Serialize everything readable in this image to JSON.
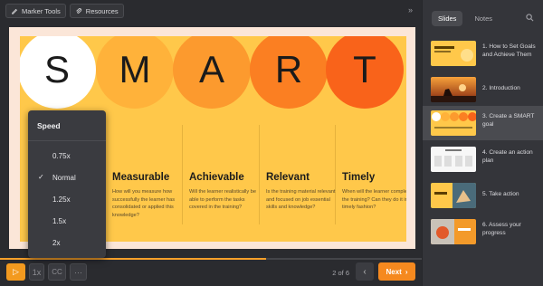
{
  "topbar": {
    "marker_tools": "Marker Tools",
    "resources": "Resources",
    "collapse": "»"
  },
  "slide": {
    "letters": [
      "S",
      "M",
      "A",
      "R",
      "T"
    ],
    "circle_colors": [
      "#ffffff",
      "#ffb23a",
      "#fc9a2e",
      "#fb7f22",
      "#f9631a"
    ],
    "columns": [
      {
        "title": "",
        "text": ""
      },
      {
        "title": "Measurable",
        "text": "How will you measure how successfully the learner has consolidated or applied this knowledge?"
      },
      {
        "title": "Achievable",
        "text": "Will the learner realistically be able to perform the tasks covered in the training?"
      },
      {
        "title": "Relevant",
        "text": "Is the training material relevant and focused on job essential skills and knowledge?"
      },
      {
        "title": "Timely",
        "text": "When will the learner complete the training? Can they do it in a timely fashion?"
      }
    ]
  },
  "speed_menu": {
    "title": "Speed",
    "options": [
      "0.75x",
      "Normal",
      "1.25x",
      "1.5x",
      "2x"
    ],
    "selected": "Normal",
    "check": "✓"
  },
  "controls": {
    "play_icon": "▷",
    "speed_label": "1x",
    "cc_label": "CC",
    "more_label": "···",
    "page_indicator": "2 of 6",
    "prev_icon": "‹",
    "next_label": "Next",
    "next_icon": "›",
    "progress": 0.63
  },
  "sidebar": {
    "tabs": [
      "Slides",
      "Notes"
    ],
    "active_tab": "Slides",
    "items": [
      {
        "label": "1. How to Set Goals and Achieve Them",
        "active": false
      },
      {
        "label": "2. Introduction",
        "active": false
      },
      {
        "label": "3. Create a SMART goal",
        "active": true
      },
      {
        "label": "4. Create an action plan",
        "active": false
      },
      {
        "label": "5. Take action",
        "active": false
      },
      {
        "label": "6. Assess your progress",
        "active": false
      }
    ]
  },
  "colors": {
    "accent": "#f5891f",
    "slide_bg": "#ffc84a",
    "sidebar_bg": "#34353a"
  }
}
